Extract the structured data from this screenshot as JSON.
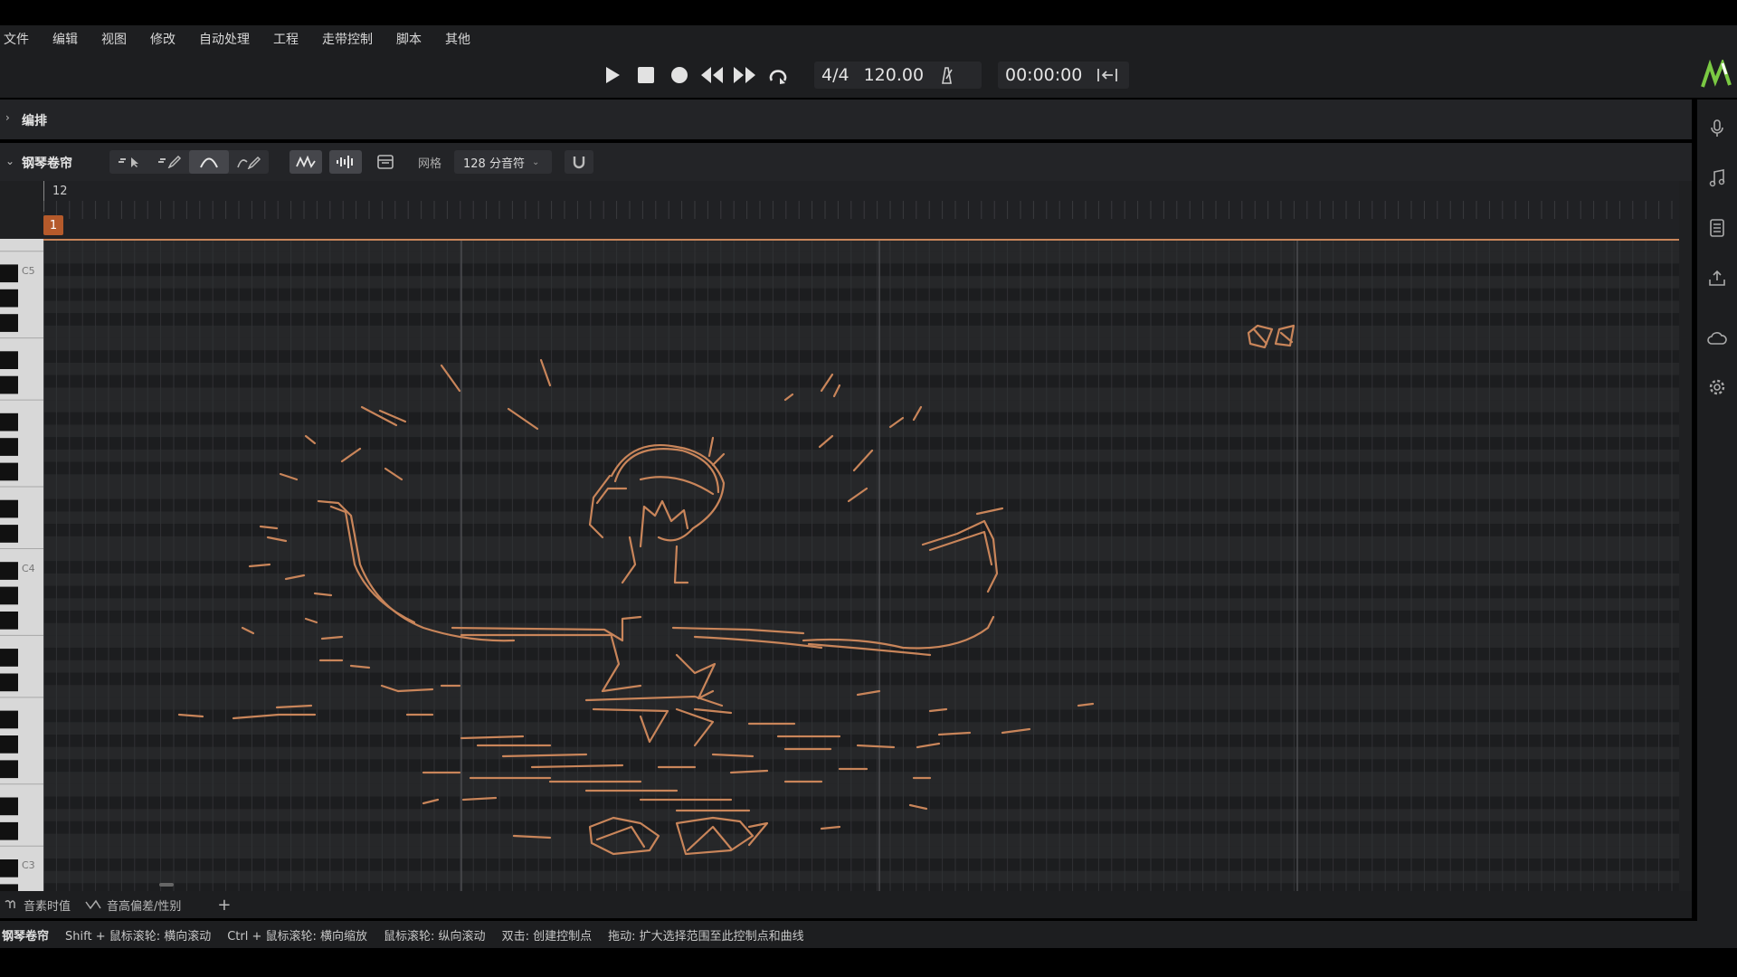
{
  "menu": [
    "文件",
    "编辑",
    "视图",
    "修改",
    "自动处理",
    "工程",
    "走带控制",
    "脚本",
    "其他"
  ],
  "transport": {
    "time_signature": "4/4",
    "tempo": "120.00",
    "time": "00:00:00",
    "icons": [
      "play-icon",
      "stop-icon",
      "record-icon",
      "rewind-icon",
      "fast-forward-icon",
      "loop-icon",
      "metronome-icon",
      "snap-back-icon"
    ]
  },
  "arrange": {
    "title": "编排"
  },
  "piano_roll": {
    "title": "钢琴卷帘",
    "grid_label": "网格",
    "grid_value": "128 分音符",
    "bar_number": "12",
    "marker": "1",
    "key_labels": [
      "C5",
      "C4",
      "C3"
    ]
  },
  "bottom_tabs": [
    "音素时值",
    "音高偏差/性别"
  ],
  "status": {
    "mode": "钢琴卷帘",
    "hints": [
      "Shift + 鼠标滚轮: 横向滚动",
      "Ctrl + 鼠标滚轮: 横向缩放",
      "鼠标滚轮: 纵向滚动",
      "双击: 创建控制点",
      "拖动: 扩大选择范围至此控制点和曲线"
    ]
  },
  "colors": {
    "accent": "#c9855a",
    "logo": "#7ac943"
  }
}
